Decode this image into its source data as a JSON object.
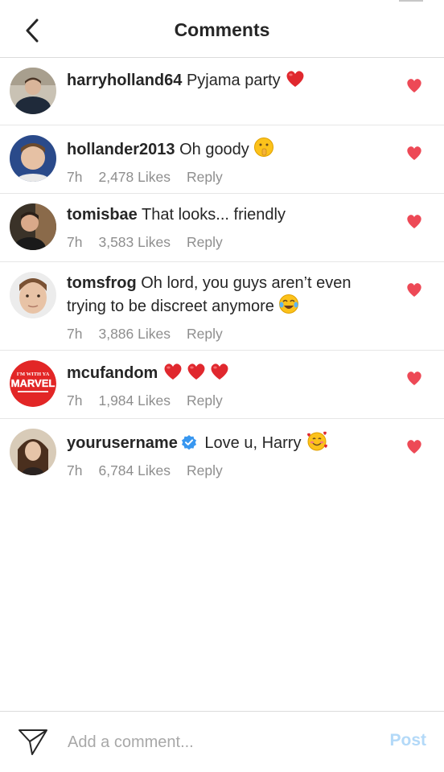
{
  "header": {
    "title": "Comments"
  },
  "comments": [
    {
      "username": "harryholland64",
      "text": "Pyjama party",
      "emoji": "heart",
      "time": "",
      "likes": "",
      "reply": ""
    },
    {
      "username": "hollander2013",
      "text": "Oh goody",
      "emoji": "shush-face",
      "time": "7h",
      "likes": "2,478 Likes",
      "reply": "Reply"
    },
    {
      "username": "tomisbae",
      "text": "That looks... friendly",
      "emoji": "",
      "time": "7h",
      "likes": "3,583 Likes",
      "reply": "Reply"
    },
    {
      "username": "tomsfrog",
      "text": "Oh lord, you guys aren’t even trying to be discreet anymore",
      "emoji": "tears-of-joy-face",
      "time": "7h",
      "likes": "3,886 Likes",
      "reply": "Reply"
    },
    {
      "username": "mcufandom",
      "text": "",
      "emoji": "three-hearts",
      "time": "7h",
      "likes": "1,984 Likes",
      "reply": "Reply"
    },
    {
      "username": "yourusername",
      "text": "Love u, Harry",
      "emoji": "smiling-face-with-hearts",
      "verified": true,
      "time": "7h",
      "likes": "6,784 Likes",
      "reply": "Reply"
    }
  ],
  "avatar_logo": {
    "line1": "I'M WITH YA",
    "line2": "MARVEL"
  },
  "composer": {
    "placeholder": "Add a comment...",
    "post_label": "Post"
  },
  "colors": {
    "like_heart": "#ed4956",
    "post_disabled": "#b3d9f8",
    "verified": "#3897f0",
    "muted_text": "#8e8e8e"
  }
}
